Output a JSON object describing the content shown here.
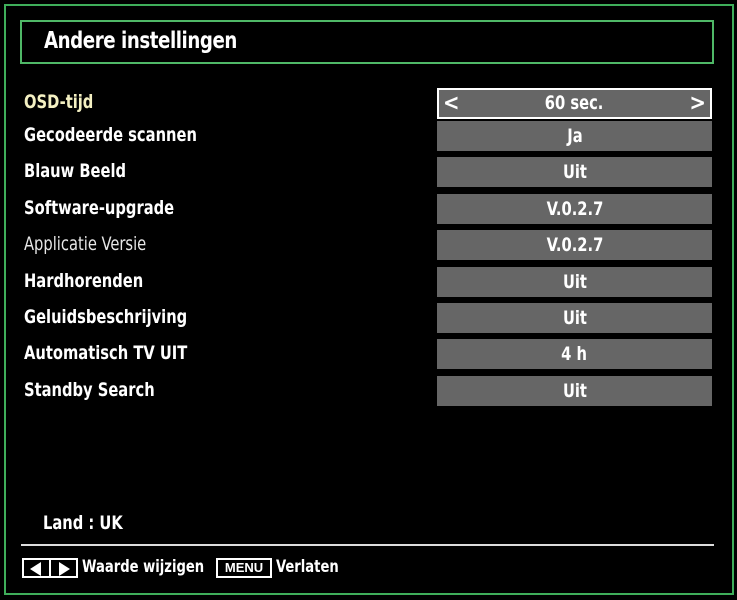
{
  "header": {
    "title": "Andere instellingen"
  },
  "settings": [
    {
      "label": "OSD-tijd",
      "value": "60 sec.",
      "selected": true
    },
    {
      "label": "Gecodeerde scannen",
      "value": "Ja"
    },
    {
      "label": "Blauw Beeld",
      "value": "Uit"
    },
    {
      "label": "Software-upgrade",
      "value": "V.0.2.7"
    },
    {
      "label": "Applicatie Versie",
      "value": "V.0.2.7"
    },
    {
      "label": "Hardhorenden",
      "value": "Uit"
    },
    {
      "label": "Geluidsbeschrijving",
      "value": "Uit"
    },
    {
      "label": "Automatisch TV UIT",
      "value": "4 h"
    },
    {
      "label": "Standby Search",
      "value": "Uit"
    }
  ],
  "selector_arrows": {
    "left": "<",
    "right": ">"
  },
  "country": "Land : UK",
  "footer": {
    "change_hint": "Waarde wijzigen",
    "menu_key": "MENU",
    "exit_hint": "Verlaten"
  },
  "colors": {
    "frame": "#3fae5a",
    "value_bg": "#666666",
    "selected_label": "#f4f0c2"
  }
}
